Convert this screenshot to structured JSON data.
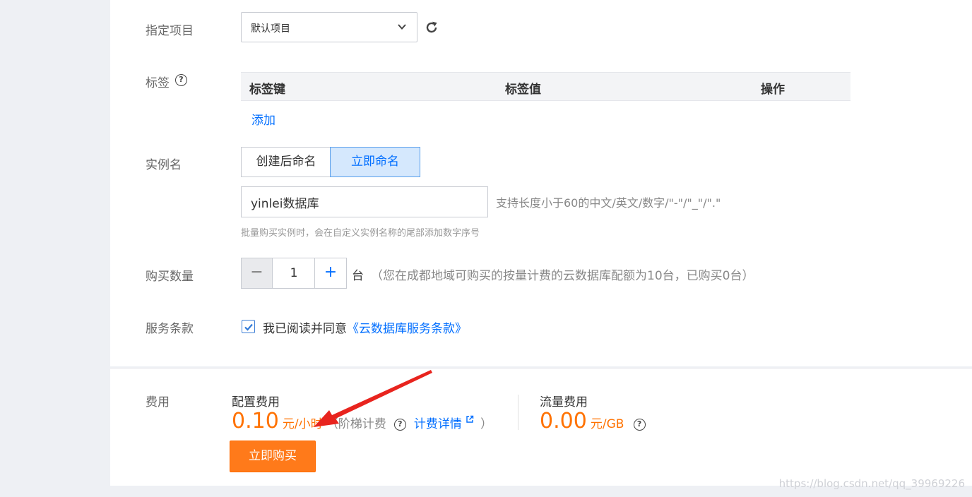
{
  "project": {
    "label": "指定项目",
    "selected": "默认项目"
  },
  "tags": {
    "label": "标签",
    "columns": [
      "标签键",
      "标签值",
      "操作"
    ],
    "add_link": "添加"
  },
  "instance_name": {
    "label": "实例名",
    "options": [
      "创建后命名",
      "立即命名"
    ],
    "active_option": "立即命名",
    "value": "yinlei数据库",
    "hint": "支持长度小于60的中文/英文/数字/\"-\"/\"_\"/\".\"",
    "sub_hint": "批量购买实例时，会在自定义实例名称的尾部添加数字序号"
  },
  "quantity": {
    "label": "购买数量",
    "value": "1",
    "minus": "−",
    "plus": "+",
    "unit": "台",
    "note": "（您在成都地域可购买的按量计费的云数据库配额为10台，已购买0台）"
  },
  "terms": {
    "label": "服务条款",
    "text": "我已阅读并同意",
    "link": "《云数据库服务条款》",
    "checked": true
  },
  "cost": {
    "label": "费用",
    "config_title": "配置费用",
    "config_price": "0.10",
    "config_unit": "元/小时",
    "tier_open": "（阶梯计费",
    "detail_link": "计费详情",
    "tier_close": "）",
    "traffic_title": "流量费用",
    "traffic_price": "0.00",
    "traffic_unit": "元/GB"
  },
  "buy_button": "立即购买",
  "watermark": "https://blog.csdn.net/qq_39969226",
  "colors": {
    "accent": "#006eff",
    "price": "#ff7200",
    "buy": "#ff7a1a",
    "arrow": "#e8241e"
  }
}
